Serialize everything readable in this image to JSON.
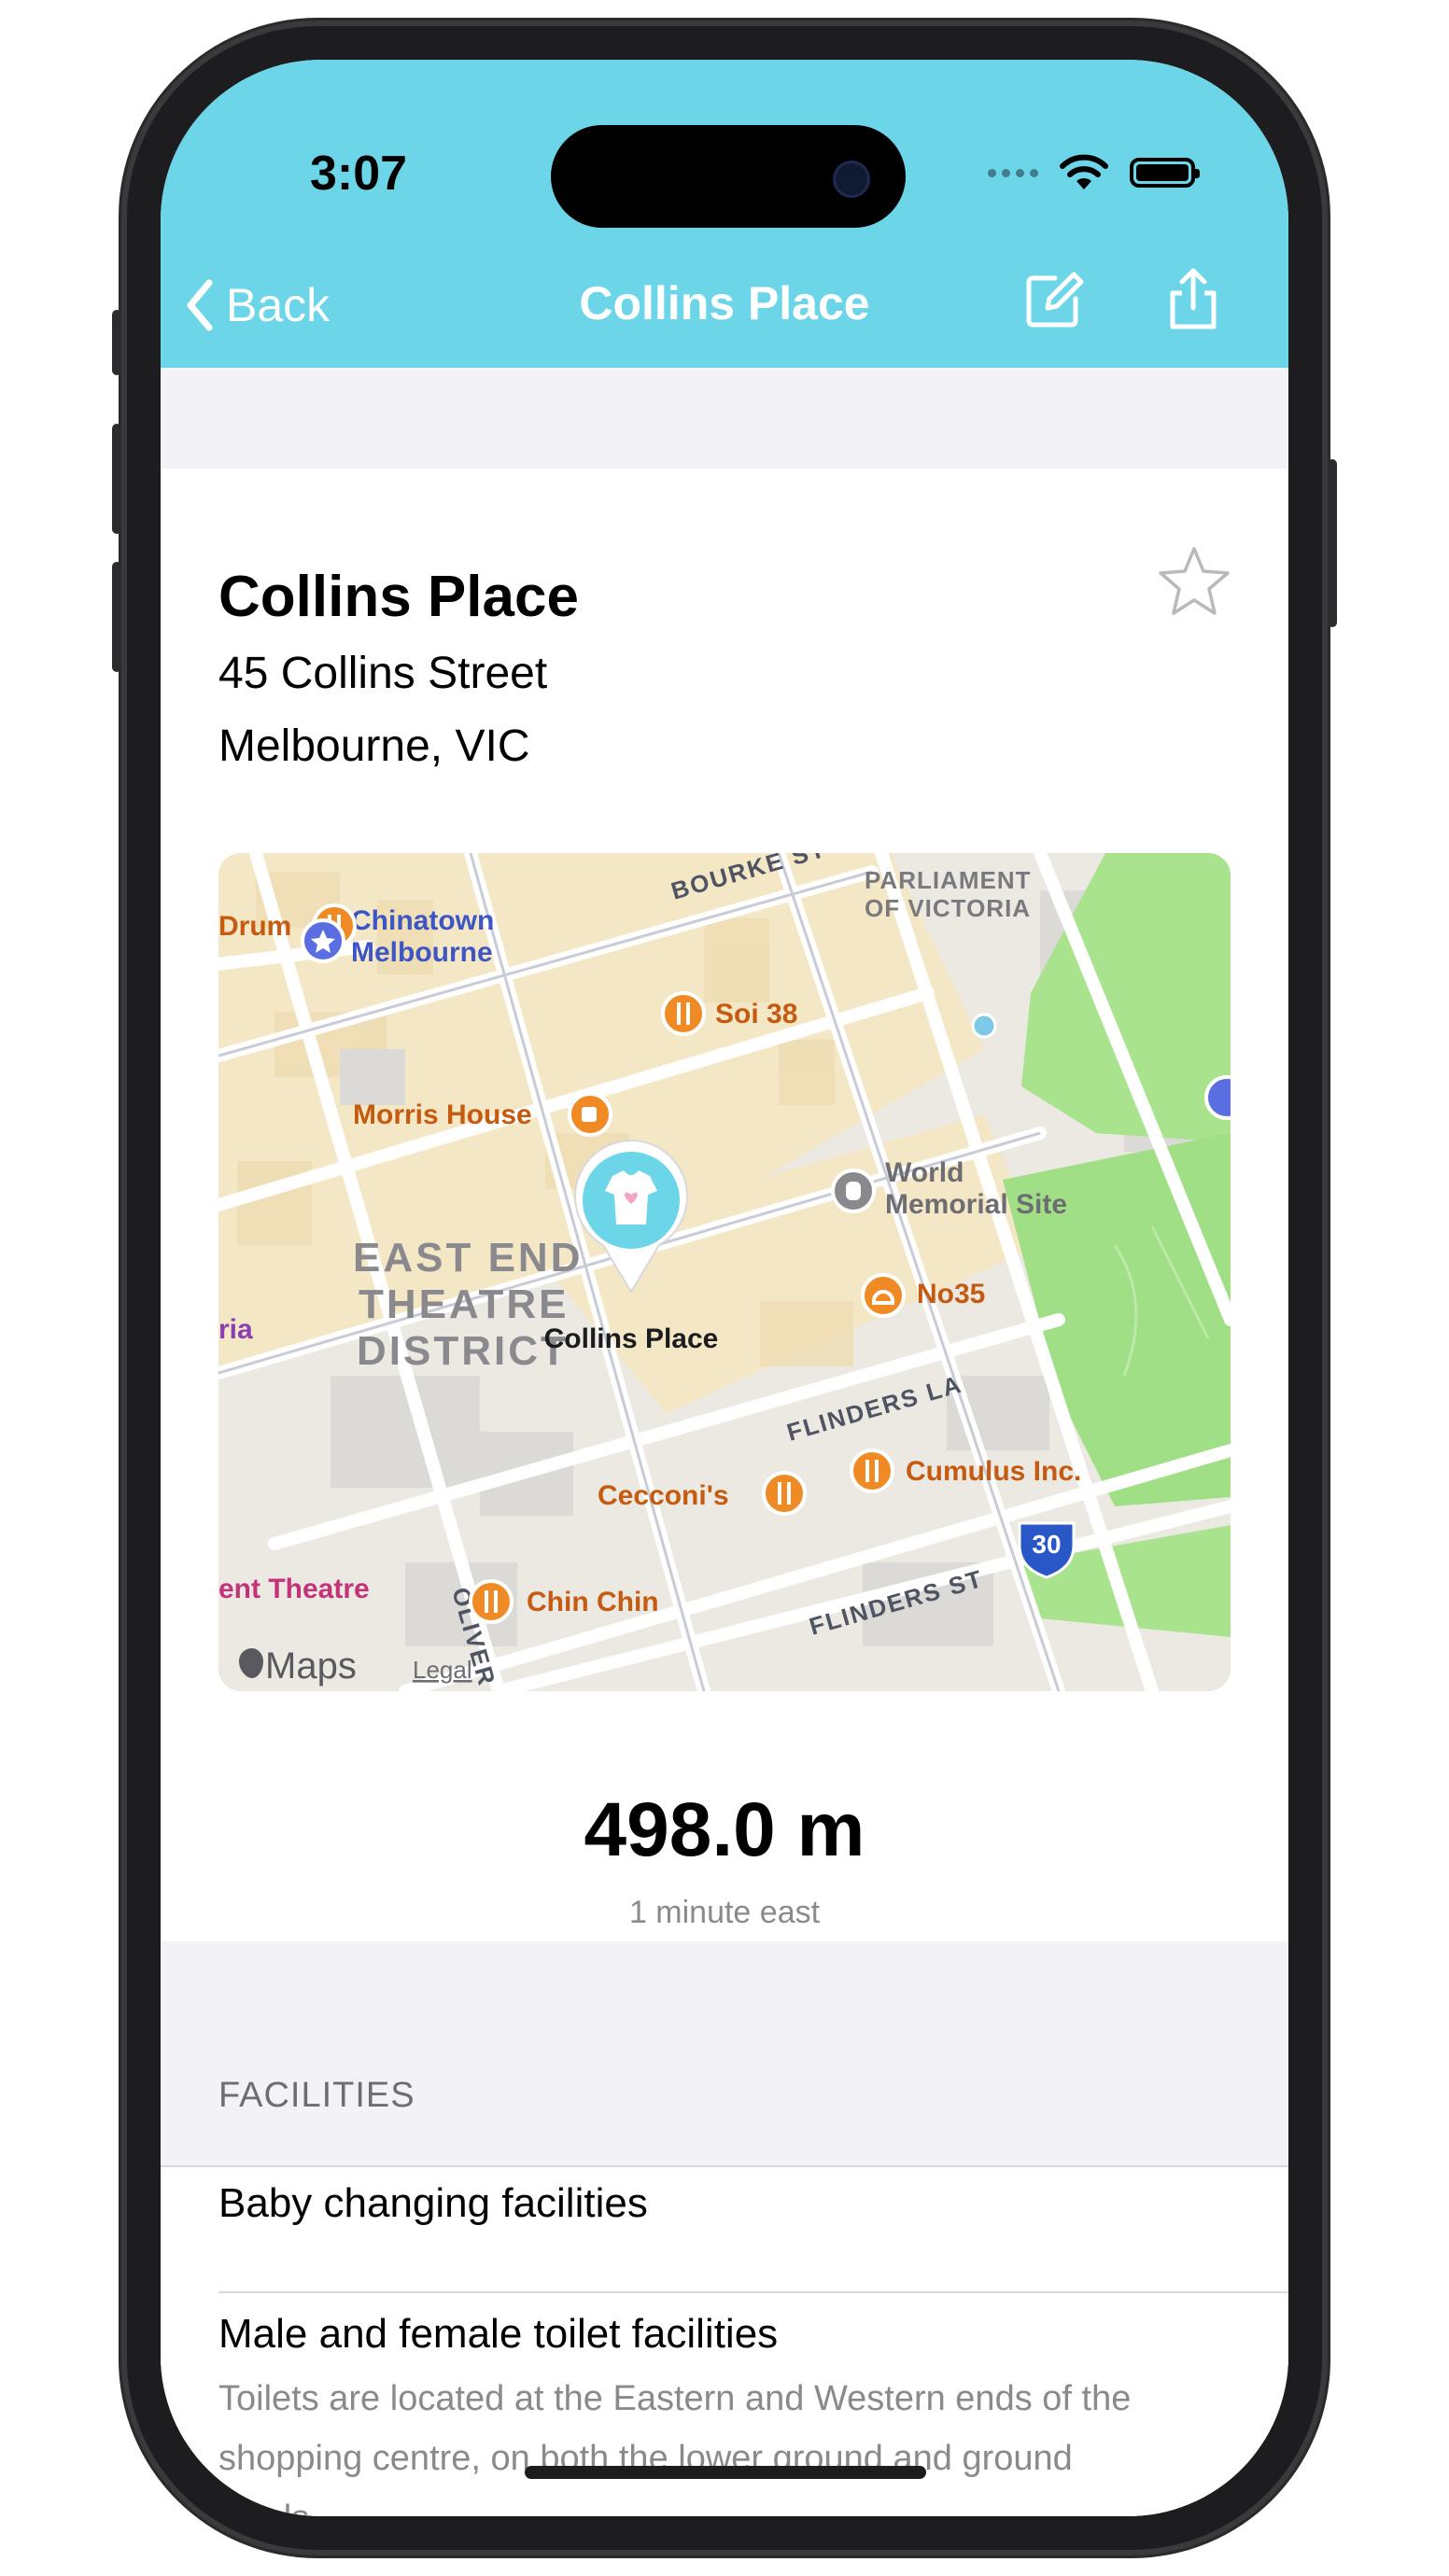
{
  "status_bar": {
    "time": "3:07"
  },
  "nav": {
    "back_label": "Back",
    "title": "Collins Place"
  },
  "place": {
    "name": "Collins Place",
    "address_line1": "45 Collins Street",
    "address_line2": "Melbourne, VIC"
  },
  "map": {
    "labels": {
      "drum": "Drum",
      "chinatown1": "Chinatown",
      "chinatown2": "Melbourne",
      "bourke": "BOURKE ST",
      "parliament1": "PARLIAMENT",
      "parliament2": "OF VICTORIA",
      "soi38": "Soi 38",
      "morris": "Morris House",
      "world1": "World",
      "world2": "Memorial Site",
      "east1": "EAST END",
      "east2": "THEATRE",
      "east3": "DISTRICT",
      "ria": "ria",
      "collins": "Collins Place",
      "no35": "No35",
      "flinders_la": "FLINDERS LA",
      "cecconi": "Cecconi's",
      "cumulus": "Cumulus Inc.",
      "route": "30",
      "theatre": "ent Theatre",
      "chinchin": "Chin Chin",
      "oliver": "OLIVER",
      "flinders_st": "FLINDERS ST",
      "brand": "Maps",
      "legal": "Legal"
    },
    "colors": {
      "food": "#f08a24",
      "landmark": "#5b6ee1",
      "park": "#9be082",
      "pin": "#6cd5e8"
    }
  },
  "distance": {
    "value": "498.0 m",
    "eta": "1 minute east"
  },
  "facilities": {
    "header": "FACILITIES",
    "items": [
      {
        "title": "Baby changing facilities"
      },
      {
        "title": "Male and female toilet facilities",
        "desc_line1": "Toilets are located at the Eastern and Western ends of the",
        "desc_line2": "shopping centre, on both the lower ground and ground",
        "desc_line3": "levels."
      }
    ]
  },
  "colors": {
    "nav_bar": "#6cd5e8",
    "group_bg": "#f2f2f7"
  }
}
